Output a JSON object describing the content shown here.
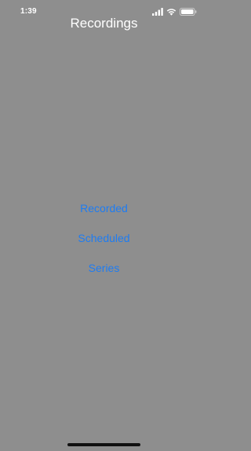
{
  "status_bar": {
    "time": "1:39",
    "icons": [
      "signal-icon",
      "wifi-icon",
      "battery-icon"
    ]
  },
  "nav": {
    "title": "Recordings"
  },
  "menu": {
    "items": [
      {
        "label": "Recorded"
      },
      {
        "label": "Scheduled"
      },
      {
        "label": "Series"
      }
    ]
  },
  "colors": {
    "background": "#8e8e8e",
    "title_text": "#ffffff",
    "button_text": "#1e7cf2",
    "home_indicator": "#111111"
  }
}
